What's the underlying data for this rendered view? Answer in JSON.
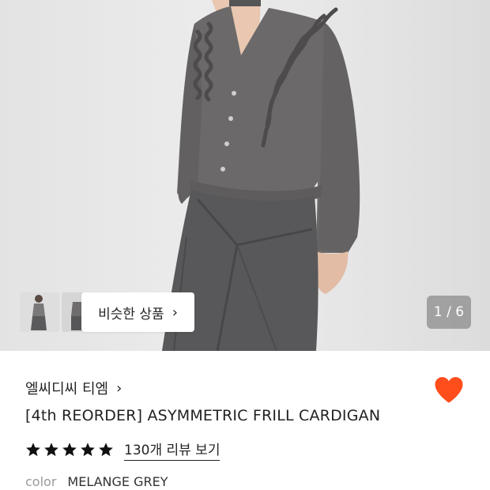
{
  "gallery": {
    "counter": "1 / 6",
    "similar_label": "비슷한 상품",
    "chevron": "›",
    "bg_color": "#e6e6e6"
  },
  "product": {
    "brand": "엘씨디씨 티엠",
    "brand_chevron": "›",
    "title": "[4th REORDER] ASYMMETRIC FRILL CARDIGAN",
    "rating_stars": 5,
    "reviews_label": "130개 리뷰 보기",
    "color_label": "color",
    "color_value": "MELANGE GREY"
  },
  "colors": {
    "heart": "#ff4d1c",
    "star": "#111111",
    "cardigan": "#6b6969",
    "skirt": "#58585a"
  }
}
